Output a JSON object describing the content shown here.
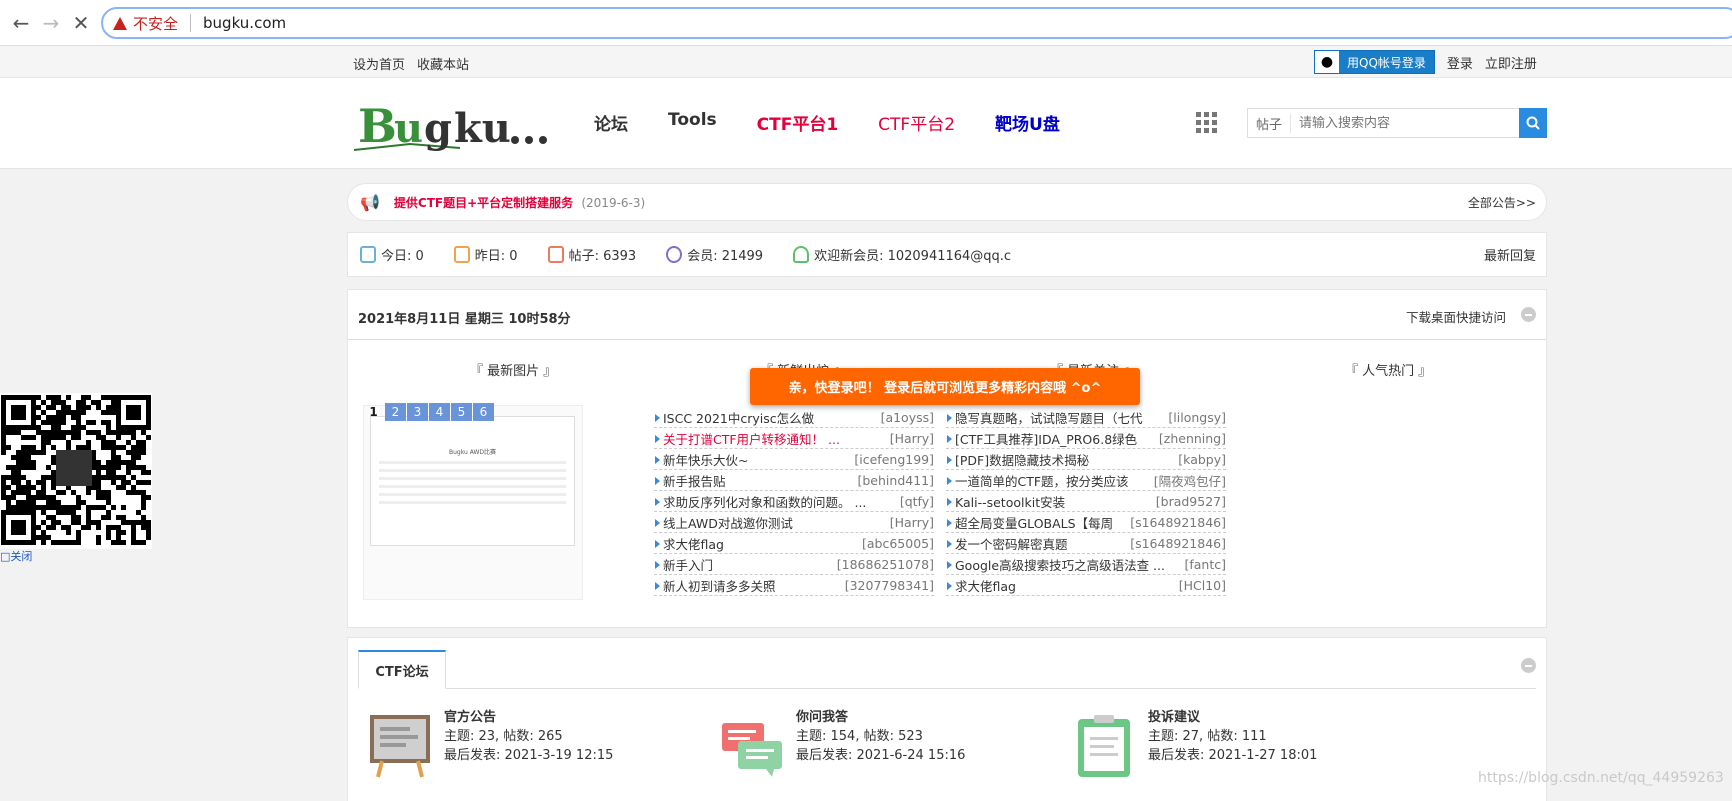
{
  "browser": {
    "security_label": "不安全",
    "url": "bugku.com"
  },
  "topbar": {
    "set_home": "设为首页",
    "bookmark": "收藏本站",
    "qq_login": "用QQ帐号登录",
    "login": "登录",
    "register": "立即注册"
  },
  "nav": {
    "items": [
      {
        "label": "论坛",
        "color": "#333333"
      },
      {
        "label": "Tools",
        "color": "#333333"
      },
      {
        "label": "CTF平台1",
        "color": "#e4003b"
      },
      {
        "label": "CTF平台2",
        "color": "#e4003b"
      },
      {
        "label": "靶场U盘",
        "color": "#0000cc"
      }
    ]
  },
  "search": {
    "label": "帖子",
    "placeholder": "请输入搜索内容"
  },
  "notice": {
    "text": "提供CTF题目+平台定制搭建服务",
    "date": "(2019-6-3)",
    "all": "全部公告>>"
  },
  "stats": {
    "today": "今日: 0",
    "yesterday": "昨日: 0",
    "posts": "帖子: 6393",
    "members": "会员: 21499",
    "welcome": "欢迎新会员: 1020941164@qq.c",
    "latest_reply": "最新回复"
  },
  "panel": {
    "datetime": "2021年8月11日 星期三 10时58分",
    "download": "下载桌面快捷访问",
    "col_titles": [
      "『 最新图片 』",
      "『 新鲜出炉 』",
      "『 最新关注 』",
      "『 人气热门 』"
    ],
    "pager": [
      "1",
      "2",
      "3",
      "4",
      "5",
      "6"
    ],
    "image_doc_title": "Bugku AWD比赛",
    "toast": "亲，快登录吧！ 登录后就可浏览更多精彩内容哦 ^o^",
    "fresh": [
      {
        "title": "ISCC 2021中cryisc怎么做",
        "user": "[a1oyss]",
        "red": false
      },
      {
        "title": "关于打谱CTF用户转移通知！ ...",
        "user": "[Harry]",
        "red": true
      },
      {
        "title": "新年快乐大伙~",
        "user": "[icefeng199]",
        "red": false
      },
      {
        "title": "新手报告贴",
        "user": "[behind411]",
        "red": false
      },
      {
        "title": "求助反序列化对象和函数的问题。 ...",
        "user": "[qtfy]",
        "red": false
      },
      {
        "title": "线上AWD对战邀你测试",
        "user": "[Harry]",
        "red": false
      },
      {
        "title": "求大佬flag",
        "user": "[abc65005]",
        "red": false
      },
      {
        "title": "新手入门",
        "user": "[18686251078]",
        "red": false
      },
      {
        "title": "新人初到请多多关照",
        "user": "[3207798341]",
        "red": false
      }
    ],
    "focus": [
      {
        "title": "隐写真题略，试试隐写题目（七代",
        "user": "[lilongsy]"
      },
      {
        "title": "[CTF工具推荐]IDA_PRO6.8绿色",
        "user": "[zhenning]"
      },
      {
        "title": "[PDF]数据隐藏技术揭秘",
        "user": "[kabpy]"
      },
      {
        "title": "一道简单的CTF题，按分类应该",
        "user": "[隔夜鸡包仔]"
      },
      {
        "title": "Kali--setoolkit安装",
        "user": "[brad9527]"
      },
      {
        "title": "超全局变量GLOBALS【每周",
        "user": "[s1648921846]"
      },
      {
        "title": "发一个密码解密真题",
        "user": "[s1648921846]"
      },
      {
        "title": "Google高级搜索技巧之高级语法查 ...",
        "user": "[fantc]"
      },
      {
        "title": "求大佬flag",
        "user": "[HCl10]"
      }
    ]
  },
  "forum": {
    "tab": "CTF论坛",
    "boards": [
      {
        "name": "官方公告",
        "topics": "主题: 23, 帖数: 265",
        "last": "最后发表: 2021-3-19 12:15"
      },
      {
        "name": "你问我答",
        "topics": "主题: 154, 帖数: 523",
        "last": "最后发表: 2021-6-24 15:16"
      },
      {
        "name": "投诉建议",
        "topics": "主题: 27, 帖数: 111",
        "last": "最后发表: 2021-1-27 18:01"
      }
    ]
  },
  "qr": {
    "close": "关闭"
  },
  "watermark": "https://blog.csdn.net/qq_44959263"
}
